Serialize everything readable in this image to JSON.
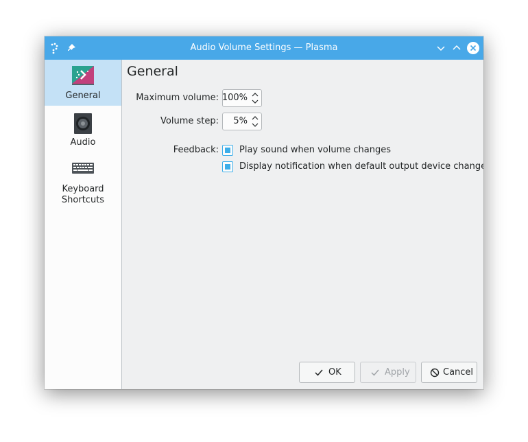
{
  "window": {
    "title": "Audio Volume Settings — Plasma",
    "accent_color": "#48a8e8"
  },
  "titlebar_icons": {
    "left": [
      "help-icon",
      "pin-icon"
    ],
    "right": [
      "minimize-icon",
      "maximize-icon",
      "close-icon"
    ]
  },
  "sidebar": {
    "items": [
      {
        "label": "General",
        "icon": "general-settings-icon",
        "selected": true
      },
      {
        "label": "Audio",
        "icon": "speaker-icon",
        "selected": false
      },
      {
        "label_line1": "Keyboard",
        "label_line2": "Shortcuts",
        "icon": "keyboard-icon",
        "selected": false
      }
    ]
  },
  "page": {
    "heading": "General",
    "max_volume": {
      "label": "Maximum volume:",
      "value": "100%"
    },
    "volume_step": {
      "label": "Volume step:",
      "value": "5%"
    },
    "feedback": {
      "label": "Feedback:",
      "options": [
        {
          "label": "Play sound when volume changes",
          "checked": true
        },
        {
          "label": "Display notification when default output device changes",
          "checked": true
        }
      ]
    }
  },
  "buttons": {
    "ok": {
      "label": "OK",
      "icon": "check-icon",
      "enabled": true
    },
    "apply": {
      "label": "Apply",
      "icon": "check-icon",
      "enabled": false
    },
    "cancel": {
      "label": "Cancel",
      "icon": "cancel-icon",
      "enabled": true
    }
  }
}
